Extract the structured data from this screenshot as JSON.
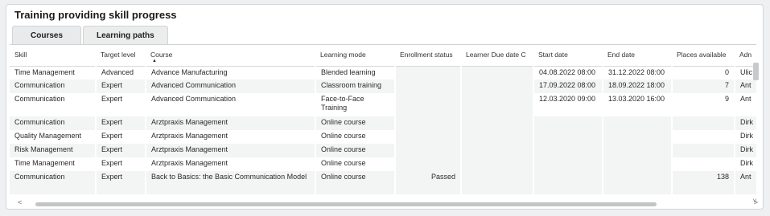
{
  "title": "Training providing skill progress",
  "tabs": [
    {
      "label": "Courses"
    },
    {
      "label": "Learning paths"
    }
  ],
  "columns": [
    "Skill",
    "Target level",
    "Course",
    "Learning mode",
    "Enrollment status",
    "Learner Due date C",
    "Start date",
    "End date",
    "Places available",
    "Adn"
  ],
  "sort_indicator": "▲",
  "rows": [
    {
      "skill": "Time Management",
      "level": "Advanced",
      "course": "Advance Manufacturing",
      "mode": "Blended learning",
      "status": "",
      "due": "",
      "start": "04.08.2022 08:00",
      "end": "31.12.2022 08:00",
      "places": "0",
      "adn": "Ulic"
    },
    {
      "skill": "Communication",
      "level": "Expert",
      "course": "Advanced Communication",
      "mode": "Classroom training",
      "status": "",
      "due": "",
      "start": "17.09.2022 08:00",
      "end": "18.09.2022 18:00",
      "places": "7",
      "adn": "Ant"
    },
    {
      "skill": "Communication",
      "level": "Expert",
      "course": "Advanced Communication",
      "mode": "Face-to-Face Training",
      "status": "",
      "due": "",
      "start": "12.03.2020 09:00",
      "end": "13.03.2020 16:00",
      "places": "9",
      "adn": "Ant"
    },
    {
      "skill": "Communication",
      "level": "Expert",
      "course": "Arztpraxis Management",
      "mode": "Online course",
      "status": "",
      "due": "",
      "start": "",
      "end": "",
      "places": "",
      "adn": "Dirk"
    },
    {
      "skill": "Quality Management",
      "level": "Expert",
      "course": "Arztpraxis Management",
      "mode": "Online course",
      "status": "",
      "due": "",
      "start": "",
      "end": "",
      "places": "",
      "adn": "Dirk"
    },
    {
      "skill": "Risk Management",
      "level": "Expert",
      "course": "Arztpraxis Management",
      "mode": "Online course",
      "status": "",
      "due": "",
      "start": "",
      "end": "",
      "places": "",
      "adn": "Dirk"
    },
    {
      "skill": "Time Management",
      "level": "Expert",
      "course": "Arztpraxis Management",
      "mode": "Online course",
      "status": "",
      "due": "",
      "start": "",
      "end": "",
      "places": "",
      "adn": "Dirk"
    },
    {
      "skill": "Communication",
      "level": "Expert",
      "course": "Back to Basics: the Basic Communication Model",
      "mode": "Online course",
      "status": "Passed",
      "due": "",
      "start": "",
      "end": "",
      "places": "138",
      "adn": "Ant"
    }
  ],
  "scroll": {
    "left_arrow": "<",
    "right_arrow": ">",
    "down_arrow": "v"
  }
}
